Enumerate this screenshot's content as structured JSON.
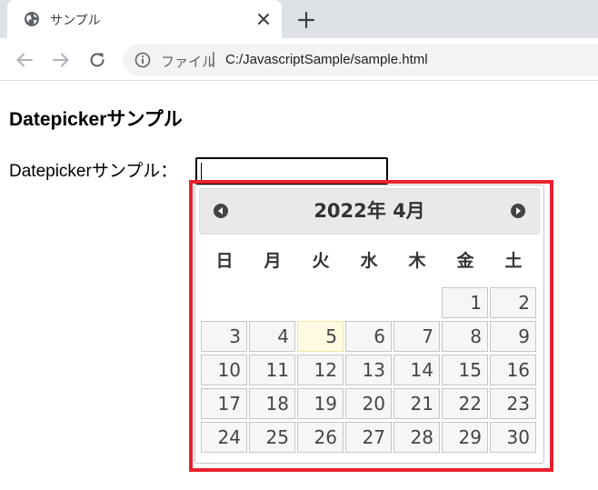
{
  "browser": {
    "tab_title": "サンプル",
    "favicon": "globe-icon",
    "close_icon": "close-icon",
    "newtab_icon": "plus-icon",
    "scheme_label": "ファイル",
    "separator": "|",
    "url": "C:/JavascriptSample/sample.html"
  },
  "page": {
    "heading": "Datepickerサンプル",
    "field_label": "Datepickerサンプル：",
    "field_value": ""
  },
  "datepicker": {
    "title": "2022年 4月",
    "prev_icon": "circle-triangle-west-icon",
    "next_icon": "circle-triangle-east-icon",
    "weekdays": [
      "日",
      "月",
      "火",
      "水",
      "木",
      "金",
      "土"
    ],
    "weeks": [
      [
        "",
        "",
        "",
        "",
        "",
        "1",
        "2"
      ],
      [
        "3",
        "4",
        "5",
        "6",
        "7",
        "8",
        "9"
      ],
      [
        "10",
        "11",
        "12",
        "13",
        "14",
        "15",
        "16"
      ],
      [
        "17",
        "18",
        "19",
        "20",
        "21",
        "22",
        "23"
      ],
      [
        "24",
        "25",
        "26",
        "27",
        "28",
        "29",
        "30"
      ]
    ],
    "today": "5",
    "highlight_color": "#e8212d"
  }
}
